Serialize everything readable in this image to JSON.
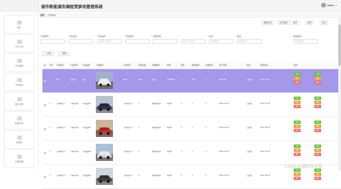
{
  "app": {
    "title": "城市新能源车辆租赁换电管理系统",
    "user_name": "admin",
    "user_caret": "▾"
  },
  "breadcrumb": {
    "home": "首页",
    "sep": "/",
    "current": "汽车信息"
  },
  "sidebar": {
    "items": [
      {
        "label": "用户",
        "icon": "user-icon"
      },
      {
        "label": "工作人员",
        "icon": "staff-icon"
      },
      {
        "label": "汽车品牌",
        "icon": "brand-icon"
      },
      {
        "label": "汽车信息",
        "icon": "car-icon"
      },
      {
        "label": "租赁订单",
        "icon": "order-icon"
      },
      {
        "label": "换电记录",
        "icon": "battery-icon"
      },
      {
        "label": "换电站",
        "icon": "station-icon"
      },
      {
        "label": "系统管理",
        "icon": "settings-icon"
      }
    ]
  },
  "toolbar": {
    "refresh": "刷新列表",
    "clear": "清空搜索",
    "search": "搜索",
    "reset": "重置",
    "export": "导出"
  },
  "filters": [
    {
      "label": "汽车编号",
      "placeholder": ""
    },
    {
      "label": "汽车名称",
      "placeholder": ""
    },
    {
      "label": "汽车品牌",
      "placeholder": "请选择汽车品牌"
    },
    {
      "label": "汽车型号",
      "placeholder": ""
    },
    {
      "label": "日期价格",
      "placeholder": ""
    },
    {
      "label": "",
      "placeholder": "请输入日期价格"
    },
    {
      "label": "状态",
      "placeholder": "请选择状态"
    },
    {
      "label": "座位",
      "placeholder": "请选择座位"
    },
    {
      "label": "电池续航",
      "placeholder": "请选择续航"
    }
  ],
  "actions": {
    "add": "+ 添加",
    "batch_delete": "- 删除"
  },
  "table": {
    "headers": [
      "序号",
      "汽车编号",
      "汽车名称",
      "汽车品牌",
      "汽车图片",
      "汽车型号",
      "日期价格",
      "车辆颜色",
      "车牌",
      "座位",
      "电池续航",
      "充电时间",
      "生产日期",
      "状态",
      "添加时间",
      "操作"
    ],
    "rows": [
      {
        "index": "1",
        "code": "001",
        "name": "迈巴赫",
        "brand": "宝马",
        "model": "MX5",
        "price": "2000",
        "color": "白色",
        "plate": "粤A8888",
        "seats": "5",
        "range": "700",
        "charge": "8",
        "date": "2024-02",
        "status": "已租赁",
        "added": "2024-04-28",
        "selected": true
      },
      {
        "index": "2",
        "code": "汽车编号2",
        "name": "汽车名称2",
        "brand": "汽车品牌2",
        "model": "汽车型号2",
        "price": "2",
        "color": "车辆颜色2",
        "plate": "车牌2",
        "seats": "2",
        "range": "2",
        "charge": "2",
        "date": "2024-04-28",
        "status": "已租赁",
        "added": "2024-04-28",
        "selected": false
      },
      {
        "index": "3",
        "code": "汽车编号3",
        "name": "汽车名称3",
        "brand": "汽车品牌3",
        "model": "汽车型号3",
        "price": "3",
        "color": "车辆颜色3",
        "plate": "车牌3",
        "seats": "3",
        "range": "3",
        "charge": "3",
        "date": "2024-04-28",
        "status": "已租赁",
        "added": "2024-04-28",
        "selected": false
      },
      {
        "index": "4",
        "code": "汽车编号4",
        "name": "汽车名称4",
        "brand": "汽车品牌4",
        "model": "汽车型号4",
        "price": "4",
        "color": "车辆颜色4",
        "plate": "车牌4",
        "seats": "4",
        "range": "4",
        "charge": "4",
        "date": "2024-04-28",
        "status": "已租赁",
        "added": "2024-04-28",
        "selected": false
      },
      {
        "index": "5",
        "code": "汽车编号5",
        "name": "汽车名称5",
        "brand": "汽车品牌5",
        "model": "汽车型号5",
        "price": "5",
        "color": "车辆颜色5",
        "plate": "车牌5",
        "seats": "5",
        "range": "5",
        "charge": "5",
        "date": "2024-04-28",
        "status": "已租赁",
        "added": "2024-04-28",
        "selected": false
      }
    ],
    "row_buttons": {
      "detail": "详情",
      "modify": "修改",
      "delete": "删除",
      "extra": "换电"
    }
  },
  "watermark": "CSDN @源码技术栈",
  "colors": {
    "selected_row": "#a398e9",
    "detail": "#67c23a",
    "modify": "#e6a23c",
    "delete": "#f56c6c"
  }
}
